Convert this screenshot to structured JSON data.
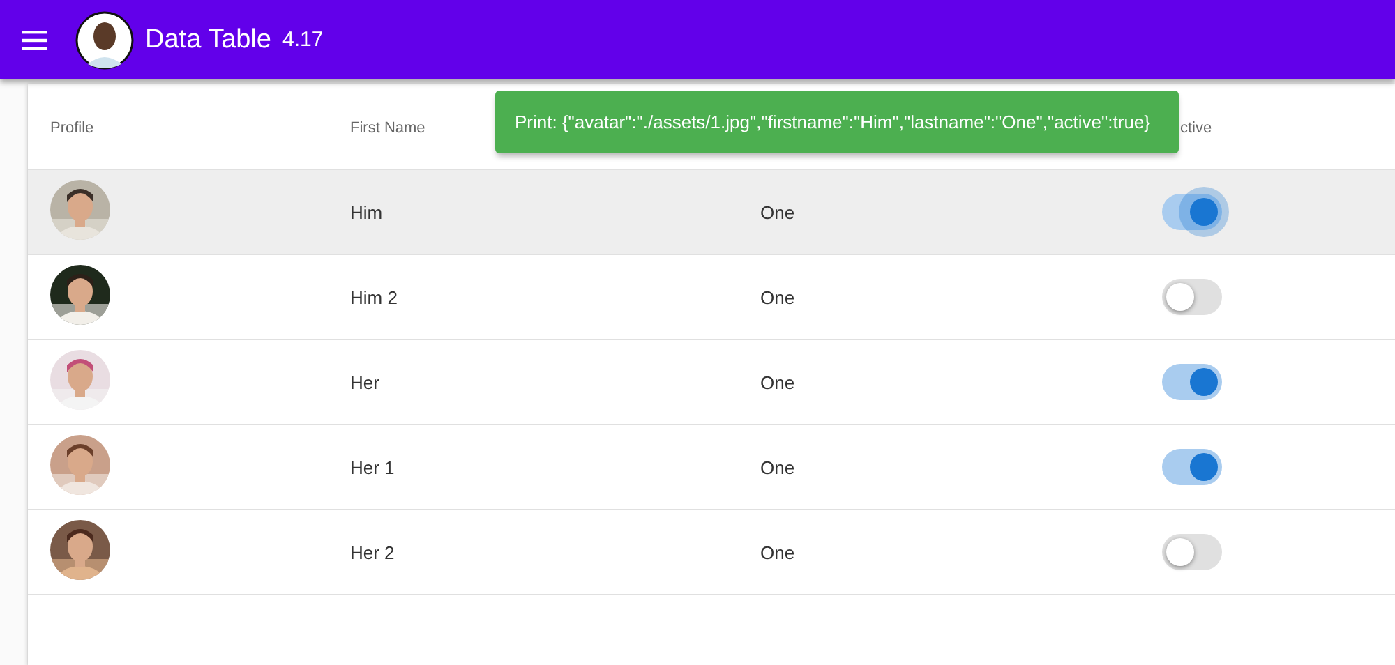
{
  "toolbar": {
    "title": "Data Table",
    "version": "4.17"
  },
  "table": {
    "columns": [
      "Profile",
      "First Name",
      "",
      "ctive"
    ],
    "rows": [
      {
        "first_name": "Him",
        "last_name": "One",
        "active": true,
        "selected": true,
        "focused": true
      },
      {
        "first_name": "Him 2",
        "last_name": "One",
        "active": false,
        "selected": false,
        "focused": false
      },
      {
        "first_name": "Her",
        "last_name": "One",
        "active": true,
        "selected": false,
        "focused": false
      },
      {
        "first_name": "Her 1",
        "last_name": "One",
        "active": true,
        "selected": false,
        "focused": false
      },
      {
        "first_name": "Her 2",
        "last_name": "One",
        "active": false,
        "selected": false,
        "focused": false
      }
    ]
  },
  "snackbar": {
    "message": "Print: {\"avatar\":\"./assets/1.jpg\",\"firstname\":\"Him\",\"lastname\":\"One\",\"active\":true}"
  }
}
